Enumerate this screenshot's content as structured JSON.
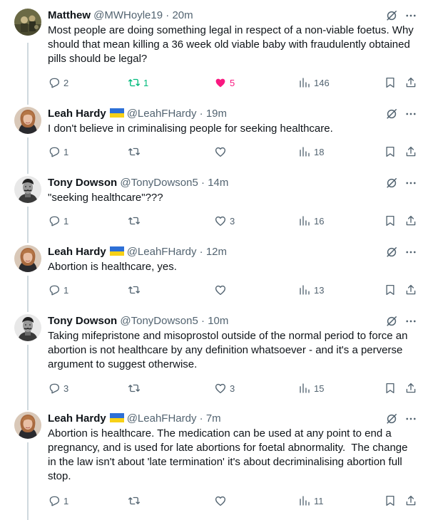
{
  "colors": {
    "text": "#0f1419",
    "secondary": "#536471",
    "retweet_green": "#00ba7c",
    "like_pink": "#f91880",
    "thread_line": "#cfd9de"
  },
  "icons": {
    "reply": "reply-icon",
    "retweet": "retweet-icon",
    "like": "heart-icon",
    "views": "views-chart-icon",
    "bookmark": "bookmark-icon",
    "share": "share-icon",
    "grok": "grok-icon",
    "more": "more-dots-icon",
    "flag": "ukraine-flag-icon"
  },
  "tweets": [
    {
      "name": "Matthew",
      "flag": false,
      "handle": "@MWHoyle19",
      "dot": "·",
      "time": "20m",
      "text": "Most people are doing something legal in respect of a non-viable foetus. Why should that mean killing a 36 week old viable baby with fraudulently obtained pills should be legal?",
      "replies": "2",
      "retweets": "1",
      "likes": "5",
      "views": "146",
      "retweeted": true,
      "liked": true
    },
    {
      "name": "Leah Hardy",
      "flag": true,
      "handle": "@LeahFHardy",
      "dot": "·",
      "time": "19m",
      "text": "I don't believe in criminalising people for seeking healthcare.",
      "replies": "1",
      "retweets": "",
      "likes": "",
      "views": "18",
      "retweeted": false,
      "liked": false
    },
    {
      "name": "Tony Dowson",
      "flag": false,
      "handle": "@TonyDowson5",
      "dot": "·",
      "time": "14m",
      "text": "\"seeking healthcare\"???",
      "replies": "1",
      "retweets": "",
      "likes": "3",
      "views": "16",
      "retweeted": false,
      "liked": false
    },
    {
      "name": "Leah Hardy",
      "flag": true,
      "handle": "@LeahFHardy",
      "dot": "·",
      "time": "12m",
      "text": "Abortion is healthcare, yes.",
      "replies": "1",
      "retweets": "",
      "likes": "",
      "views": "13",
      "retweeted": false,
      "liked": false
    },
    {
      "name": "Tony Dowson",
      "flag": false,
      "handle": "@TonyDowson5",
      "dot": "·",
      "time": "10m",
      "text": "Taking mifepristone and misoprostol outside of the normal period to force an abortion is not healthcare by any definition whatsoever - and it's a perverse argument to suggest otherwise.",
      "replies": "3",
      "retweets": "",
      "likes": "3",
      "views": "15",
      "retweeted": false,
      "liked": false
    },
    {
      "name": "Leah Hardy",
      "flag": true,
      "handle": "@LeahFHardy",
      "dot": "·",
      "time": "7m",
      "text": "Abortion is healthcare. The medication can be used at any point to end a pregnancy, and is used for late abortions for foetal abnormality.  The change in the law isn't about 'late termination' it's about decriminalising abortion full stop.",
      "replies": "1",
      "retweets": "",
      "likes": "",
      "views": "11",
      "retweeted": false,
      "liked": false
    }
  ]
}
